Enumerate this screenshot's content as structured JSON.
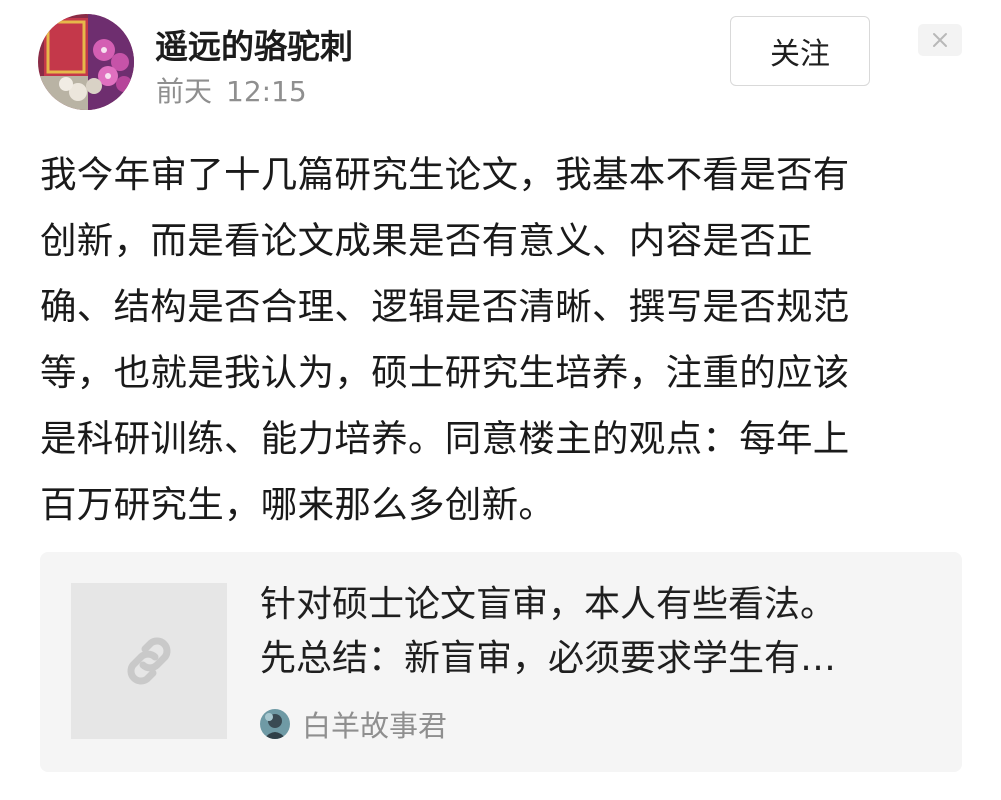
{
  "post": {
    "author": {
      "name": "遥远的骆驼刺",
      "avatar_icon": "avatar-flowers-icon"
    },
    "time": {
      "day": "前天",
      "clock": "12:15"
    },
    "follow_label": "关注",
    "close_icon": "close-icon",
    "body_lines": [
      "我今年审了十几篇研究生论文，我基本不看是否有",
      "创新，而是看论文成果是否有意义、内容是否正",
      "确、结构是否合理、逻辑是否清晰、撰写是否规范",
      "等，也就是我认为，硕士研究生培养，注重的应该",
      "是科研训练、能力培养。同意楼主的观点：每年上",
      "百万研究生，哪来那么多创新。"
    ],
    "shared_link": {
      "thumbnail_icon": "link-icon",
      "title_lines": [
        "针对硕士论文盲审，本人有些看法。",
        "先总结：新盲审，必须要求学生有…"
      ],
      "author": "白羊故事君"
    }
  },
  "colors": {
    "text_primary": "#1a1a1a",
    "text_secondary": "#8f8f8f",
    "card_background": "#f5f5f5",
    "thumb_background": "#e6e6e6",
    "button_border": "#d9d9d9"
  }
}
